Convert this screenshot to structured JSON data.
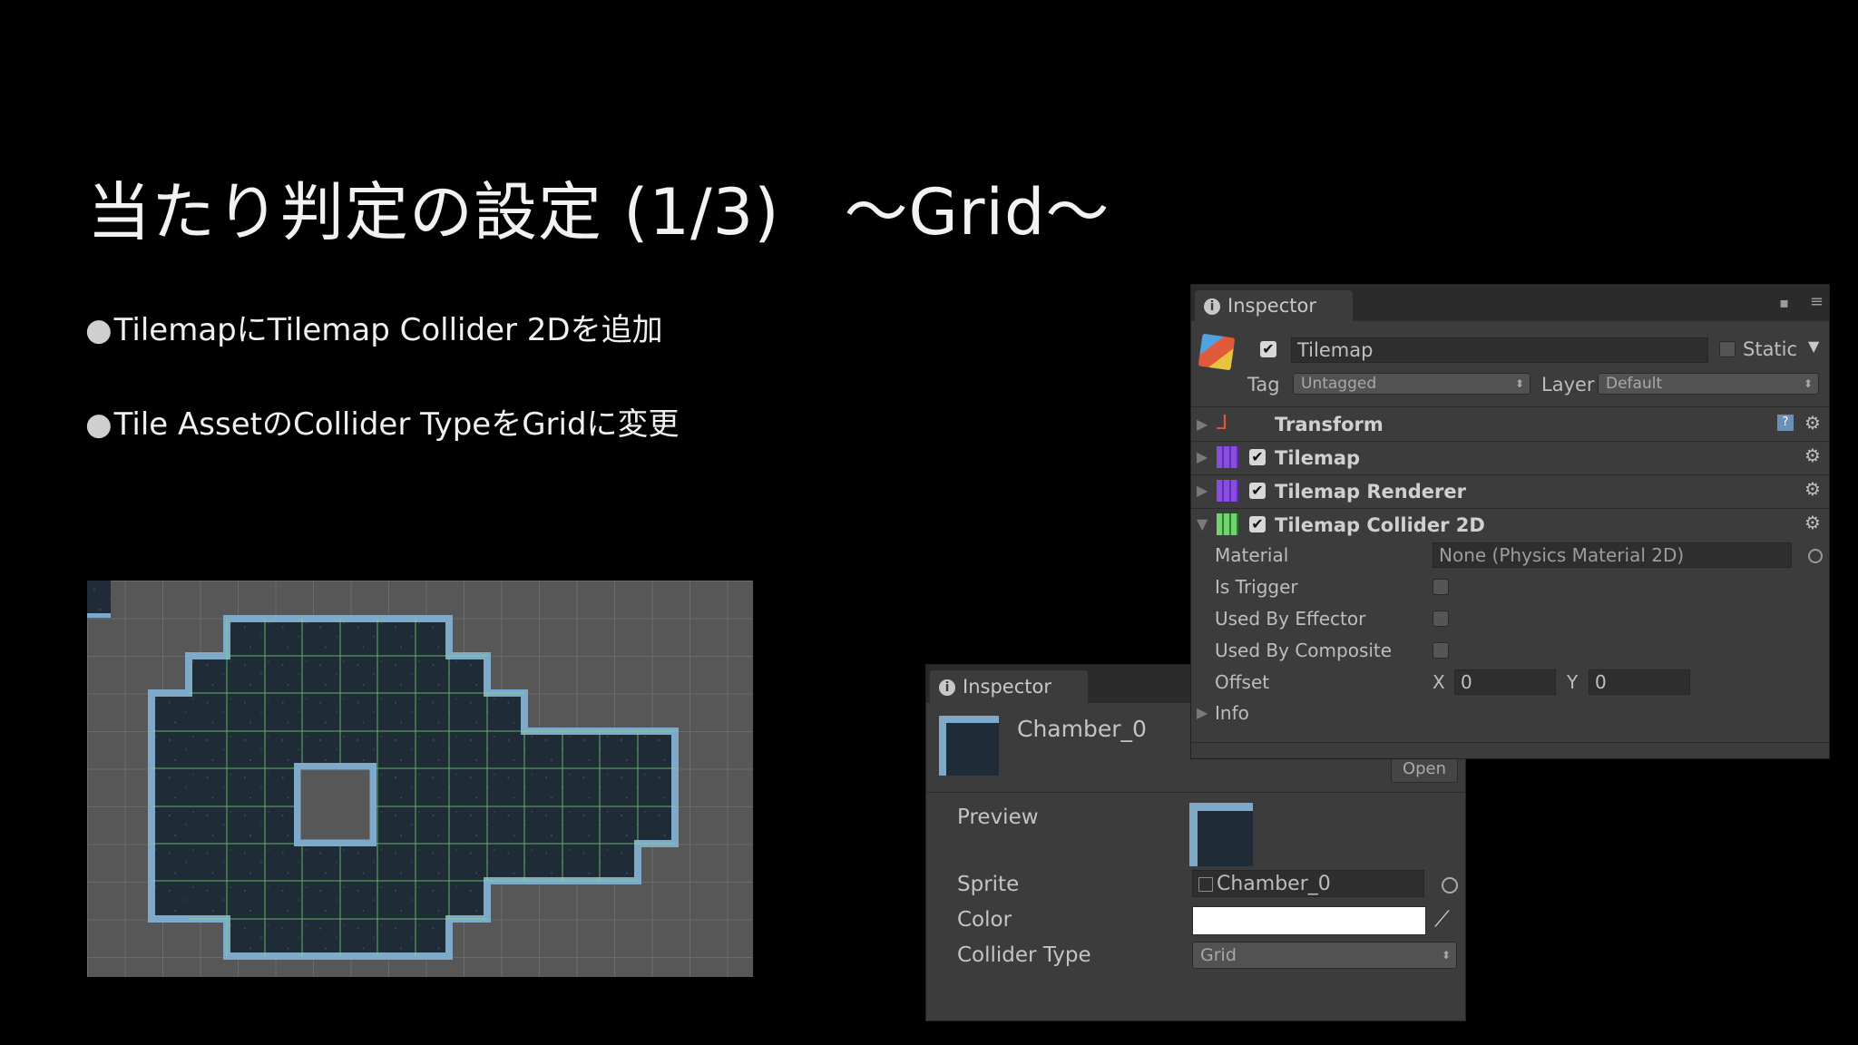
{
  "slide": {
    "title": "当たり判定の設定 (1/3)　～Grid～",
    "bullets": [
      "TilemapにTilemap Collider 2Dを追加",
      "Tile AssetのCollider TypeをGridに変更"
    ],
    "bullet_glyph": "●"
  },
  "inspector_top": {
    "tab_label": "Inspector",
    "object_name": "Tilemap",
    "static_label": "Static",
    "tag_label": "Tag",
    "tag_value": "Untagged",
    "layer_label": "Layer",
    "layer_value": "Default",
    "components": [
      "Transform",
      "Tilemap",
      "Tilemap Renderer",
      "Tilemap Collider 2D"
    ],
    "material_label": "Material",
    "material_value": "None (Physics Material 2D)",
    "is_trigger_label": "Is Trigger",
    "used_by_effector_label": "Used By Effector",
    "used_by_composite_label": "Used By Composite",
    "offset_label": "Offset",
    "offset_x_label": "X",
    "offset_x": "0",
    "offset_y_label": "Y",
    "offset_y": "0",
    "info_label": "Info"
  },
  "inspector_bottom": {
    "tab_label": "Inspector",
    "asset_name": "Chamber_0",
    "open_label": "Open",
    "preview_label": "Preview",
    "sprite_label": "Sprite",
    "sprite_value": "Chamber_0",
    "color_label": "Color",
    "collider_type_label": "Collider Type",
    "collider_type_value": "Grid"
  },
  "colors": {
    "background": "#000000",
    "panel": "#3c3c3c",
    "tile_fill": "#1e2a35",
    "tile_border": "#7ea9c9",
    "collider_green": "#7ddc7d"
  }
}
